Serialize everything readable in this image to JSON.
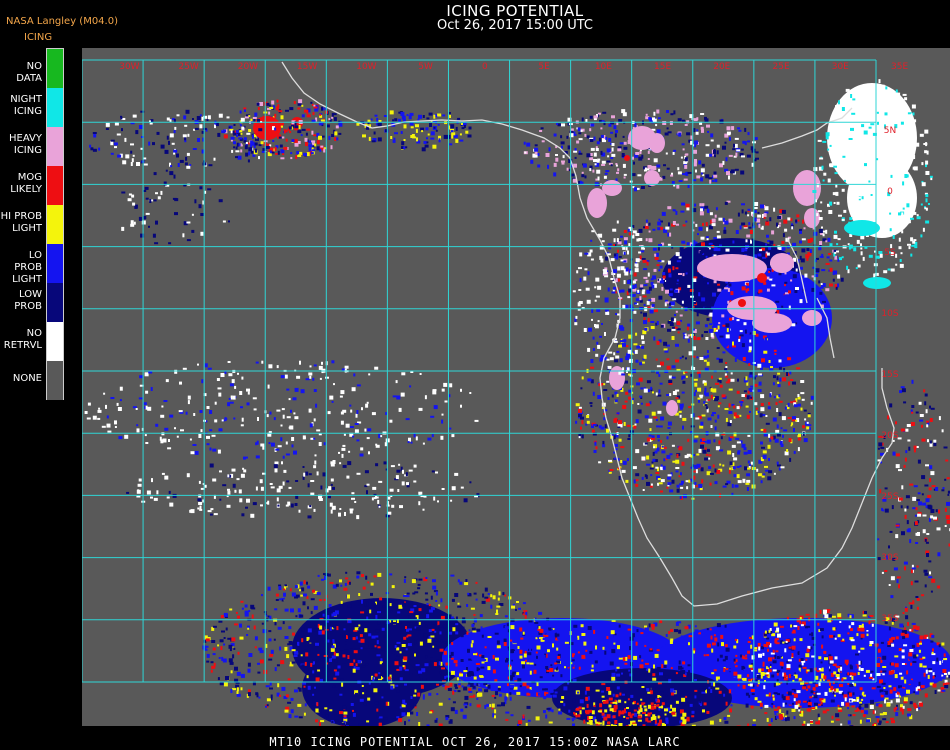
{
  "header": {
    "source": "NASA Langley (M04.0)",
    "product": "ICING",
    "title": "ICING POTENTIAL",
    "subtitle": "Oct 26, 2017 15:00 UTC"
  },
  "legend": [
    {
      "label": "NO DATA",
      "color": "#17b81f"
    },
    {
      "label": "NIGHT\nICING",
      "color": "#10e7e7"
    },
    {
      "label": "HEAVY\nICING",
      "color": "#e9a3d9"
    },
    {
      "label": "MOG\nLIKELY",
      "color": "#ee0e12"
    },
    {
      "label": "HI PROB\nLIGHT",
      "color": "#f4f40c"
    },
    {
      "label": "LO PROB\nLIGHT",
      "color": "#1414f0"
    },
    {
      "label": "LOW\nPROB",
      "color": "#07077a"
    },
    {
      "label": "NO\nRETRVL",
      "color": "#ffffff"
    },
    {
      "label": "NONE",
      "color": "#595959"
    }
  ],
  "grid": {
    "longitudes": [
      "30W",
      "25W",
      "20W",
      "15W",
      "10W",
      "5W",
      "0",
      "5E",
      "10E",
      "15E",
      "20E",
      "25E",
      "30E",
      "35E"
    ],
    "latitudes": [
      "5N",
      "0",
      "5S",
      "10S",
      "15S",
      "20S",
      "25S",
      "30S",
      "35S"
    ]
  },
  "footer": "MT10  ICING POTENTIAL   OCT 26, 2017 15:00Z   NASA LARC"
}
